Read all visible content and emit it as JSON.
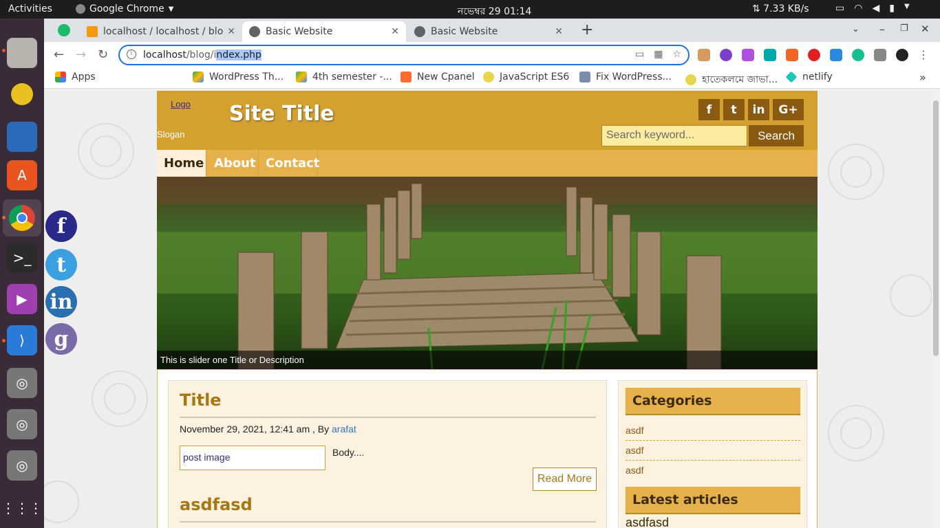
{
  "os": {
    "activities": "Activities",
    "app_name": "Google Chrome",
    "clock": "নভেম্বর 29  01:14",
    "net_speed": "⇅ 7.33 KB/s"
  },
  "browser": {
    "tabs": [
      {
        "label": "localhost / localhost / blo"
      },
      {
        "label": "Basic Website"
      },
      {
        "label": "Basic Website"
      }
    ],
    "url_host": "localhost",
    "url_path_dim": "/blog/i",
    "url_selected": "ndex.php",
    "bookmarks": [
      {
        "label": "Apps"
      },
      {
        "label": "WordPress Th..."
      },
      {
        "label": "4th semester -..."
      },
      {
        "label": "New Cpanel"
      },
      {
        "label": "JavaScript ES6"
      },
      {
        "label": "Fix WordPress..."
      },
      {
        "label": "হাতেকলমে জাভা..."
      },
      {
        "label": "netlify"
      }
    ]
  },
  "site": {
    "logo_alt": "Logo",
    "title": "Site Title",
    "slogan": "Slogan",
    "social": [
      "f",
      "t",
      "in",
      "G+"
    ],
    "search_placeholder": "Search keyword...",
    "search_button": "Search",
    "menu": [
      "Home",
      "About",
      "Contact"
    ],
    "slider_caption": "This is slider one Title or Description"
  },
  "posts": [
    {
      "title": "Title",
      "meta": "November 29, 2021, 12:41 am , By ",
      "author": "arafat",
      "image_alt": "post image",
      "body": "Body....",
      "read_more": "Read More"
    },
    {
      "title": "asdfasd"
    }
  ],
  "sidebar": {
    "categories_title": "Categories",
    "categories": [
      "asdf",
      "asdf",
      "asdf"
    ],
    "latest_title": "Latest articles",
    "latest": [
      "asdfasd"
    ]
  },
  "colors": {
    "header": "#d4a030",
    "menu": "#e6b04a",
    "accent_dark": "#8a5a12",
    "dock": "#3a2b38"
  }
}
